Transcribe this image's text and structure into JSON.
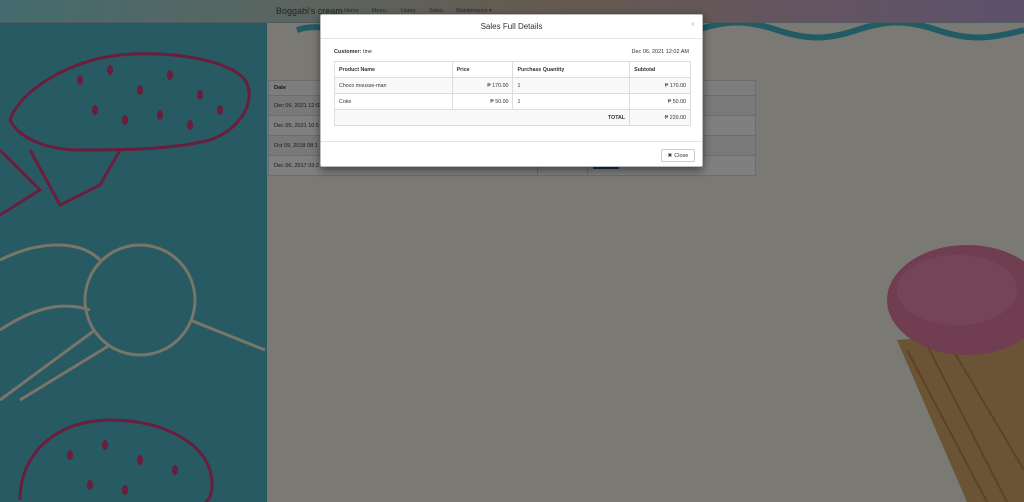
{
  "navbar": {
    "brand": "Boggabi's cream",
    "items": [
      {
        "label": "Home"
      },
      {
        "label": "Menu"
      },
      {
        "label": "Users"
      },
      {
        "label": "Sales"
      },
      {
        "label": "Maintenance ▾"
      }
    ]
  },
  "page_table": {
    "header_date": "Date",
    "rows": [
      {
        "date": "Dec 06, 2021 12:02"
      },
      {
        "date": "Dec 05, 2021 10:5"
      },
      {
        "date": "Oct 09, 2018 08:1"
      },
      {
        "date": "Dec 06, 2017 03:2"
      }
    ]
  },
  "modal": {
    "title": "Sales Full Details",
    "close_x": "×",
    "customer_label": "Customer:",
    "customer_name": "tine",
    "date": "Dec 06, 2021 12:02 AM",
    "columns": [
      "Product Name",
      "Price",
      "Purchase Quantity",
      "Subtotal"
    ],
    "rows": [
      {
        "product": "Choco mousse-man",
        "price": "₱ 170.00",
        "qty": "1",
        "subtotal": "₱ 170.00"
      },
      {
        "product": "Coke",
        "price": "₱ 50.00",
        "qty": "1",
        "subtotal": "₱ 50.00"
      }
    ],
    "total_label": "TOTAL",
    "total_value": "₱ 220.00",
    "close_button": "Close",
    "close_icon_glyph": "✖"
  },
  "colors": {
    "left_panel": "#4fb4c7",
    "right_panel": "#f6f3e6",
    "doodle_pink": "#d43a7a",
    "doodle_cream": "#f3ead0",
    "wave_teal": "#43b8c9",
    "ice_cream_pink": "#e07aa2",
    "button_blue": "#2f5f9e"
  }
}
